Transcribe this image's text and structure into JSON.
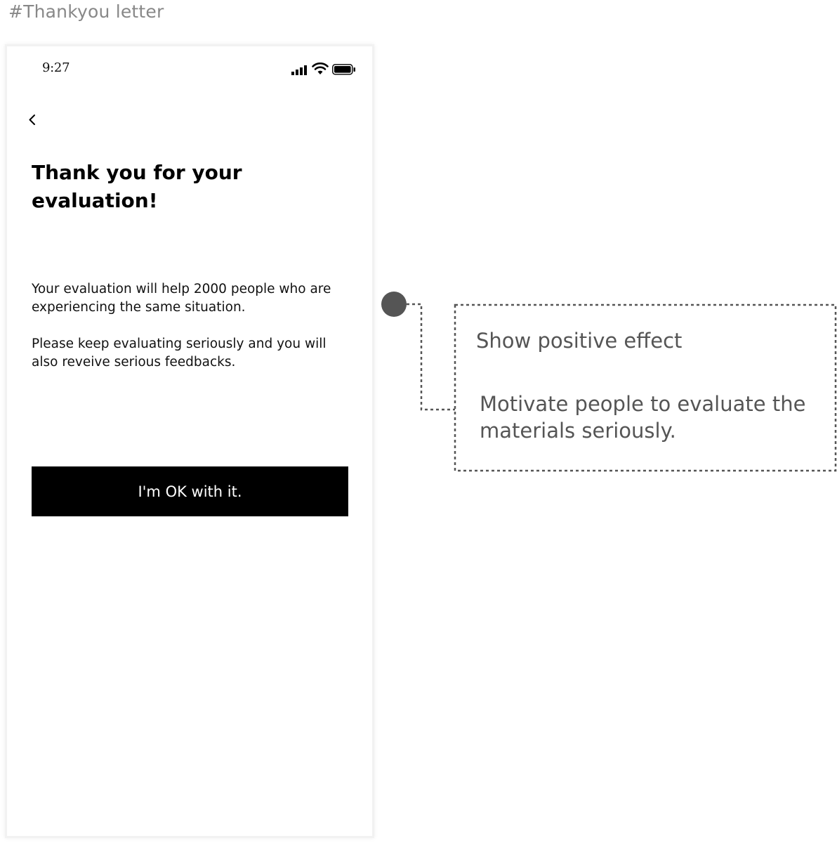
{
  "frame": {
    "label": "#Thankyou letter"
  },
  "phone": {
    "status_bar": {
      "time": "9:27",
      "icons": [
        "signal-icon",
        "wifi-icon",
        "battery-icon"
      ]
    },
    "nav": {
      "back_icon": "chevron-left-icon"
    },
    "title": "Thank you for your evaluation!",
    "paragraphs": [
      "Your evaluation will help 2000 people who are experiencing the same situation.",
      "Please keep evaluating seriously and you will also reveive serious feedbacks."
    ],
    "primary_button": "I'm OK with it."
  },
  "annotation": {
    "title": "Show positive effect",
    "body": "Motivate people to evaluate the materials seriously."
  },
  "colors": {
    "button_bg": "#000000",
    "button_text": "#ffffff",
    "annotation_text": "#555555",
    "annotation_dot": "#555555",
    "frame_label": "#888888"
  }
}
